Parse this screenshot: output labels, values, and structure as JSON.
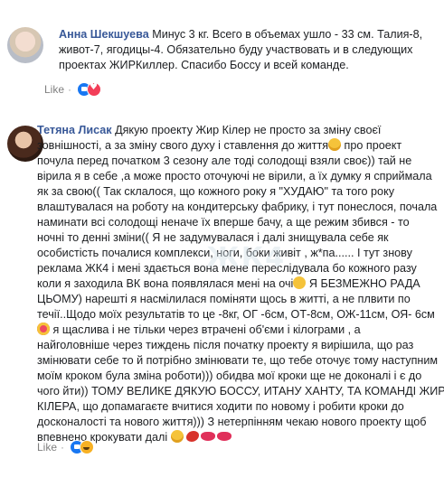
{
  "comments": [
    {
      "author": "Анна Шекшуева",
      "lines": [
        " Минус 3 кг. Всего в объемах ушло - 33 см. Талия-8,",
        "живот-7, ягодицы-4. Обязательно буду участвовать и в следующих",
        "проектах ЖИРКиллер. Спасибо Боссу и всей команде."
      ],
      "like_label": "Like",
      "reactions": [
        "like",
        "love"
      ]
    },
    {
      "author": "Тетяна Лисак",
      "lines": [
        " Дякую проекту Жир Кілер не просто за зміну своєї",
        "зовнішності, а за зміну свого духу і ставлення до життя",
        "почула перед початком 3 сезону але тоді солодощі взяли своє)) тай не",
        "вірила я в себе ,а може просто оточуючі не вірили, а їх думку я сприймала",
        "як за свою(( Так склалося, що кожного року я \"ХУДАЮ\" та того року",
        "влаштувалася на роботу на кондитерську фабрику, і тут понеслося, почала",
        "наминати всі солодощі неначе їх вперше бачу, а ще режим збився - то",
        "ночні то денні зміни(( Я не задумувалася і далі знищувала себе як",
        "особистість почалися комплекси, ноги, боки живіт , ж*па...... І тут знову",
        "реклама ЖК4 і мені здається вона мене переслідувала бо кожного разу",
        "коли я заходила ВК вона появлялася мені на очі",
        "ЦЬОМУ) нарешті я насмілилася поміняти щось в житті, а не плвити по",
        "течії..Щодо моїх результатів то це -8кг, ОГ -6см, ОТ-8см, ОЖ-11см, ОЯ- 6см",
        " я щаслива і не тільки через втрачені об'єми і кілограми , а",
        "найголовніше через тиждень після початку проекту я вирішила, що раз",
        "змінювати себе то й потрібно змінювати те, що тебе оточує тому наступним",
        "моїм кроком була зміна роботи))) обидва мої кроки ще не доконалі і є до",
        "чого йти)) ТОМУ ВЕЛИКЕ ДЯКУЮ БОССУ, ИТАНУ ХАНТУ, ТА КОМАНДІ ЖИР",
        "КІЛЕРА, що допамагаєте вчитися ходити по новому і робити кроки до",
        "досконалості та нового життя))) З нетерпінням чекаю нового проекту щоб",
        "впевнено крокувати далі"
      ],
      "line1_tail": " про проект",
      "line11_tail": " Я БЕЗМЕЖНО РАДА",
      "like_label": "Like",
      "reactions": [
        "like",
        "haha"
      ]
    }
  ],
  "separator": "·",
  "watermark": "ЖК4",
  "colors": {
    "author": "#385898",
    "like": "#1877f2",
    "love": "#f33e58",
    "haha": "#f7b125"
  }
}
